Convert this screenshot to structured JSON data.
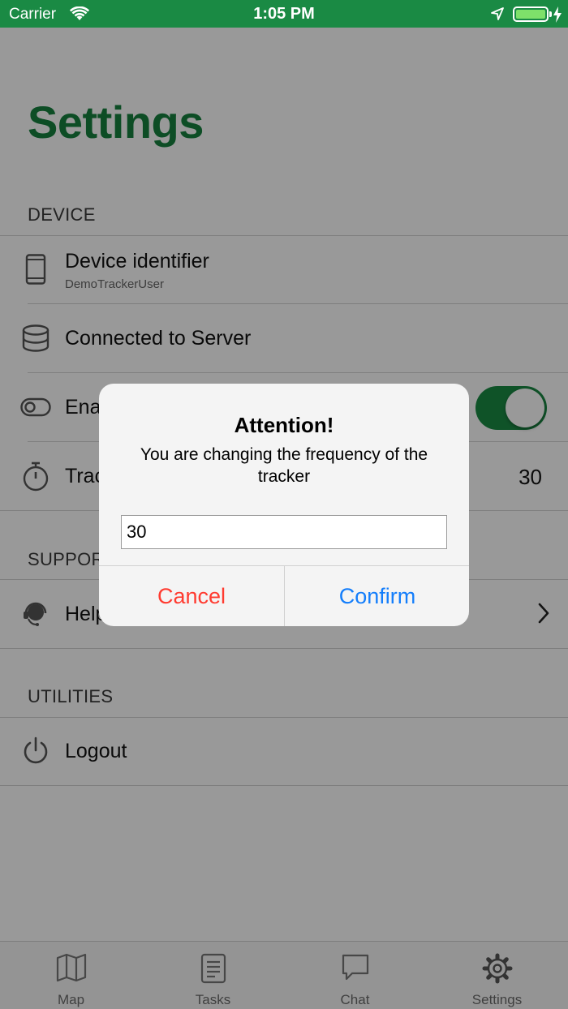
{
  "status_bar": {
    "carrier": "Carrier",
    "time": "1:05 PM",
    "battery_level": 1.0
  },
  "page": {
    "title": "Settings"
  },
  "sections": {
    "device": {
      "header": "DEVICE",
      "rows": {
        "device_identifier": {
          "label": "Device identifier",
          "sublabel": "DemoTrackerUser",
          "icon": "phone-icon"
        },
        "connected": {
          "label": "Connected to Server",
          "icon": "database-icon"
        },
        "enable": {
          "label": "Ena",
          "icon": "toggle-icon",
          "toggle_on": true
        },
        "tracker": {
          "label": "Trac",
          "value": "30",
          "icon": "stopwatch-icon"
        }
      }
    },
    "support": {
      "header": "SUPPOR",
      "rows": {
        "help": {
          "label": "Help",
          "icon": "headset-icon"
        }
      }
    },
    "utilities": {
      "header": "UTILITIES",
      "rows": {
        "logout": {
          "label": "Logout",
          "icon": "power-icon"
        }
      }
    }
  },
  "tabbar": {
    "tabs": [
      {
        "label": "Map",
        "icon": "map-icon"
      },
      {
        "label": "Tasks",
        "icon": "tasks-icon"
      },
      {
        "label": "Chat",
        "icon": "chat-icon"
      },
      {
        "label": "Settings",
        "icon": "gear-icon"
      }
    ]
  },
  "alert": {
    "title": "Attention!",
    "message": "You are changing the frequency of the tracker",
    "input_value": "30",
    "cancel_label": "Cancel",
    "confirm_label": "Confirm"
  },
  "colors": {
    "brand_green": "#16803f",
    "status_bar": "#1a8a44",
    "cancel": "#ff3b30",
    "confirm": "#147efb"
  }
}
